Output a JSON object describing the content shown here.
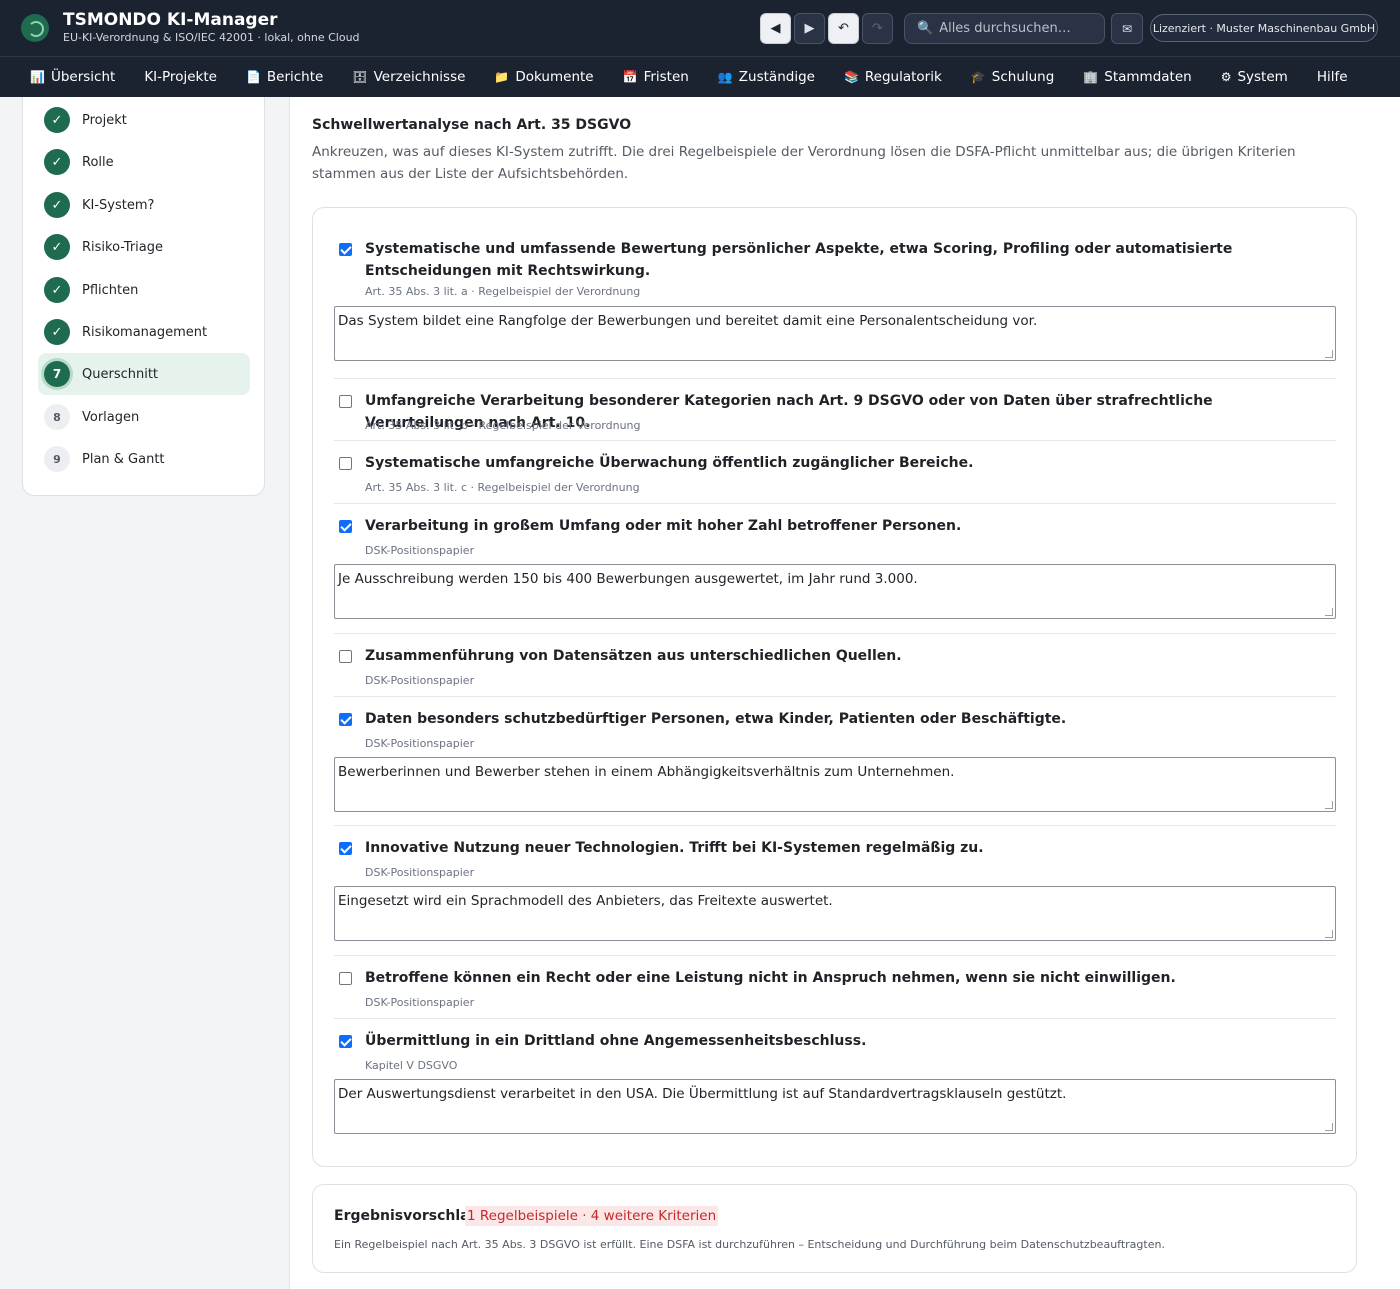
{
  "app": {
    "title": "TSMONDO KI-Manager",
    "subtitle": "EU-KI-Verordnung & ISO/IEC 42001 · lokal, ohne Cloud",
    "search_placeholder": "Alles durchsuchen…",
    "license": "Lizenziert · Muster Maschinenbau GmbH"
  },
  "nav": [
    {
      "label": "Übersicht",
      "icon": "📊"
    },
    {
      "label": "KI-Projekte",
      "icon": ""
    },
    {
      "label": "Berichte",
      "icon": "📄"
    },
    {
      "label": "Verzeichnisse",
      "icon": "🗄"
    },
    {
      "label": "Dokumente",
      "icon": "📁"
    },
    {
      "label": "Fristen",
      "icon": "📅"
    },
    {
      "label": "Zuständige",
      "icon": "👥"
    },
    {
      "label": "Regulatorik",
      "icon": "📚"
    },
    {
      "label": "Schulung",
      "icon": "🎓"
    },
    {
      "label": "Stammdaten",
      "icon": "🏢"
    },
    {
      "label": "System",
      "icon": "⚙"
    },
    {
      "label": "Hilfe",
      "icon": ""
    }
  ],
  "steps": [
    {
      "num": "✓",
      "label": "Projekt",
      "state": "done"
    },
    {
      "num": "✓",
      "label": "Rolle",
      "state": "done"
    },
    {
      "num": "✓",
      "label": "KI-System?",
      "state": "done"
    },
    {
      "num": "✓",
      "label": "Risiko-Triage",
      "state": "done"
    },
    {
      "num": "✓",
      "label": "Pflichten",
      "state": "done"
    },
    {
      "num": "✓",
      "label": "Risikomanagement",
      "state": "done"
    },
    {
      "num": "7",
      "label": "Querschnitt",
      "state": "current"
    },
    {
      "num": "8",
      "label": "Vorlagen",
      "state": "todo"
    },
    {
      "num": "9",
      "label": "Plan & Gantt",
      "state": "todo"
    }
  ],
  "section": {
    "title": "Schwellwertanalyse nach Art. 35 DSGVO",
    "description": "Ankreuzen, was auf dieses KI-System zutrifft. Die drei Regelbeispiele der Verordnung lösen die DSFA-Pflicht unmittelbar aus; die übrigen Kriterien stammen aus der Liste der Aufsichtsbehörden."
  },
  "criteria": [
    {
      "checked": true,
      "title": "Systematische und umfassende Bewertung persönlicher Aspekte, etwa Scoring, Profiling oder automatisierte Entscheidungen mit Rechtswirkung.",
      "source": "Art. 35 Abs. 3 lit. a · Regelbeispiel der Verordnung",
      "note": "Das System bildet eine Rangfolge der Bewerbungen und bereitet damit eine Personalentscheidung vor."
    },
    {
      "checked": false,
      "title": "Umfangreiche Verarbeitung besonderer Kategorien nach Art. 9 DSGVO oder von Daten über strafrechtliche Verurteilungen nach Art. 10.",
      "source": "Art. 35 Abs. 3 lit. b · Regelbeispiel der Verordnung",
      "note": ""
    },
    {
      "checked": false,
      "title": "Systematische umfangreiche Überwachung öffentlich zugänglicher Bereiche.",
      "source": "Art. 35 Abs. 3 lit. c · Regelbeispiel der Verordnung",
      "note": ""
    },
    {
      "checked": true,
      "title": "Verarbeitung in großem Umfang oder mit hoher Zahl betroffener Personen.",
      "source": "DSK-Positionspapier",
      "note": "Je Ausschreibung werden 150 bis 400 Bewerbungen ausgewertet, im Jahr rund 3.000."
    },
    {
      "checked": false,
      "title": "Zusammenführung von Datensätzen aus unterschiedlichen Quellen.",
      "source": "DSK-Positionspapier",
      "note": ""
    },
    {
      "checked": true,
      "title": "Daten besonders schutzbedürftiger Personen, etwa Kinder, Patienten oder Beschäftigte.",
      "source": "DSK-Positionspapier",
      "note": "Bewerberinnen und Bewerber stehen in einem Abhängigkeitsverhältnis zum Unternehmen."
    },
    {
      "checked": true,
      "title": "Innovative Nutzung neuer Technologien. Trifft bei KI-Systemen regelmäßig zu.",
      "source": "DSK-Positionspapier",
      "note": "Eingesetzt wird ein Sprachmodell des Anbieters, das Freitexte auswertet."
    },
    {
      "checked": false,
      "title": "Betroffene können ein Recht oder eine Leistung nicht in Anspruch nehmen, wenn sie nicht einwilligen.",
      "source": "DSK-Positionspapier",
      "note": ""
    },
    {
      "checked": true,
      "title": "Übermittlung in ein Drittland ohne Angemessenheitsbeschluss.",
      "source": "Kapitel V DSGVO",
      "note": "Der Auswertungsdienst verarbeitet in den USA. Die Übermittlung ist auf Standardvertragsklauseln gestützt."
    }
  ],
  "result": {
    "title": "Ergebnisvorschlag",
    "badge": "1 Regelbeispiele · 4 weitere Kriterien",
    "text": "Ein Regelbeispiel nach Art. 35 Abs. 3 DSGVO ist erfüllt. Eine DSFA ist durchzuführen – Entscheidung und Durchführung beim Datenschutzbeauftragten."
  }
}
